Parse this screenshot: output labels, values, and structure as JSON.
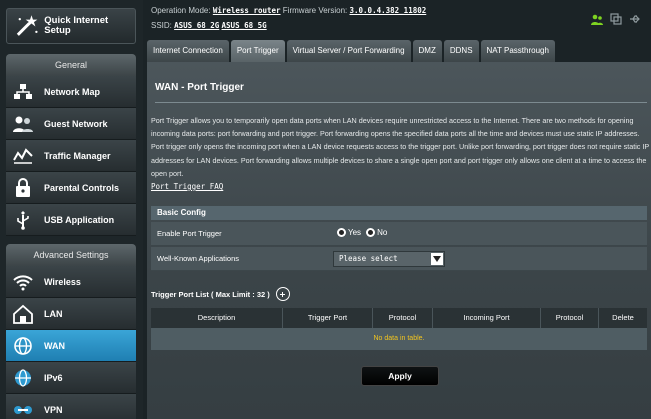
{
  "sidebar": {
    "quick_setup": "Quick Internet Setup",
    "general_title": "General",
    "general_items": [
      {
        "label": "Network Map",
        "icon": "network-map-icon"
      },
      {
        "label": "Guest Network",
        "icon": "guest-network-icon"
      },
      {
        "label": "Traffic Manager",
        "icon": "traffic-manager-icon"
      },
      {
        "label": "Parental Controls",
        "icon": "parental-controls-icon"
      },
      {
        "label": "USB Application",
        "icon": "usb-application-icon"
      }
    ],
    "advanced_title": "Advanced Settings",
    "advanced_items": [
      {
        "label": "Wireless",
        "icon": "wireless-icon"
      },
      {
        "label": "LAN",
        "icon": "lan-icon"
      },
      {
        "label": "WAN",
        "icon": "wan-icon",
        "active": true
      },
      {
        "label": "IPv6",
        "icon": "ipv6-icon"
      },
      {
        "label": "VPN",
        "icon": "vpn-icon"
      }
    ]
  },
  "topbar": {
    "operation_mode_label": "Operation Mode:",
    "operation_mode_value": "Wireless router",
    "firmware_label": "Firmware Version:",
    "firmware_value": "3.0.0.4.382_11802",
    "ssid_label": "SSID:",
    "ssid_1": "ASUS_68_2G",
    "ssid_2": "ASUS_68_5G"
  },
  "tabs": [
    "Internet Connection",
    "Port Trigger",
    "Virtual Server / Port Forwarding",
    "DMZ",
    "DDNS",
    "NAT Passthrough"
  ],
  "main": {
    "title": "WAN - Port Trigger",
    "description": "Port Trigger allows you to temporarily open data ports when LAN devices require unrestricted access to the Internet. There are two methods for opening incoming data ports: port forwarding and port trigger. Port forwarding opens the specified data ports all the time and devices must use static IP addresses. Port trigger only opens the incoming port when a LAN device requests access to the trigger port. Unlike port forwarding, port trigger does not require static IP addresses for LAN devices. Port forwarding allows multiple devices to share a single open port and port trigger only allows one client at a time to access the open port.",
    "faq_link": "Port Trigger FAQ",
    "basic_config": "Basic Config",
    "enable_label": "Enable Port Trigger",
    "yes_label": "Yes",
    "no_label": "No",
    "well_known_label": "Well-Known Applications",
    "select_value": "Please select",
    "list_title": "Trigger Port List ( Max Limit : 32 )",
    "columns": [
      "Description",
      "Trigger Port",
      "Protocol",
      "Incoming Port",
      "Protocol",
      "Delete"
    ],
    "empty_text": "No data in table.",
    "apply_label": "Apply"
  },
  "colors": {
    "active_menu": "#2a93c8",
    "empty_text": "#f3c51f",
    "status_green": "#7ed321"
  }
}
